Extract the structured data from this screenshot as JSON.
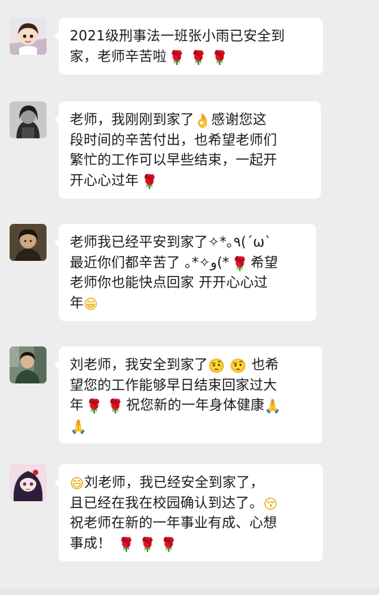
{
  "colors": {
    "background": "#ededed",
    "bubble": "#ffffff",
    "text": "#1a1a1a",
    "rose": "#d2232a"
  },
  "messages": [
    {
      "avatar_icon": "cartoon-boy-avatar-icon",
      "lines": [
        "2021级刑事法一班张小雨已安全到",
        "家，老师辛苦啦"
      ],
      "trail_emojis": [
        "🌹",
        "🌹",
        "🌹"
      ]
    },
    {
      "avatar_icon": "dark-portrait-avatar-icon",
      "lines": [
        "老师，我刚刚到家了",
        "感谢您这",
        "段时间的辛苦付出，也希望老师们",
        "繁忙的工作可以早些结束，一起开",
        "开心心过年"
      ],
      "emoji_ok": "👌",
      "emoji_rose": "🌹"
    },
    {
      "avatar_icon": "sepia-portrait-avatar-icon",
      "lines": [
        "老师我已经平安到家了✧*｡٩(ˊωˋ",
        "最近你们都辛苦了  ｡*✧و(*",
        "希望",
        "老师你也能快点回家 开开心心过",
        "年"
      ],
      "emoji_rose": "🌹",
      "emoji_grin": "😁"
    },
    {
      "avatar_icon": "photo-boy-avatar-icon",
      "lines": [
        "刘老师，我安全到家了",
        "也希",
        "望您的工作能够早日结束回家过大",
        "年",
        "祝您新的一年身体健康"
      ],
      "emoji_smirk": "🤨",
      "emoji_rose": "🌹",
      "emoji_hands": "🙏"
    },
    {
      "avatar_icon": "anime-girl-avatar-icon",
      "lines": [
        "刘老师，我已经安全到家了，",
        "且已经在我在校园确认到达了。",
        "祝老师在新的一年事业有成、心想",
        "事成！"
      ],
      "emoji_grin": "😄",
      "emoji_kiss": "😚",
      "emoji_rose": "🌹"
    }
  ]
}
